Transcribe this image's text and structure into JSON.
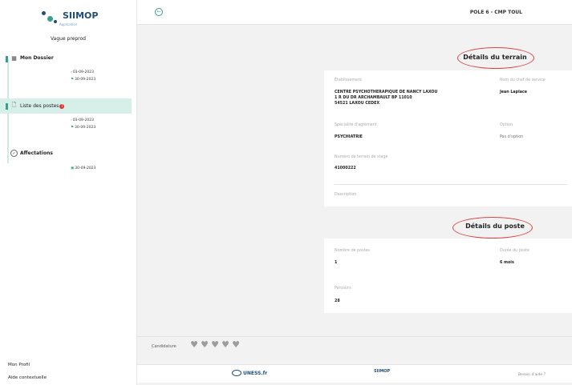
{
  "sidebar": {
    "logo_text": "SIIMOP",
    "logo_sub": "Application",
    "vague": "Vague preprod",
    "steps": [
      {
        "label": "Mon Dossier",
        "dates": [
          "03-09-2023",
          "30-09-2023"
        ]
      },
      {
        "label": "Liste des postes",
        "badge": "1",
        "dates": [
          "03-09-2023",
          "30-09-2023"
        ]
      },
      {
        "label": "Affectations",
        "dates": [
          "30-09-2023"
        ]
      }
    ],
    "links": {
      "profile": "Mon Profil",
      "help": "Aide contextuelle"
    }
  },
  "header": {
    "pole": "POLE 6 - CMP TOUL"
  },
  "terrain": {
    "title": "Détails du terrain",
    "etablissement_label": "Établissement",
    "etablissement_lines": [
      "CENTRE PSYCHOTHERAPIQUE DE NANCY LAXOU",
      "1 R DU DR ARCHAMBAULT BP 11010",
      "54521 LAXOU CEDEX"
    ],
    "chef_label": "Nom du chef de service",
    "chef_value": "Jean Laplace",
    "specialite_label": "Spécialité d'agrément",
    "specialite_value": "PSYCHIATRIE",
    "option_label": "Option",
    "option_value": "Pas d'option",
    "terrain_num_label": "Numéro de terrain de stage",
    "terrain_num_value": "41000222",
    "description_label": "Description"
  },
  "poste": {
    "title": "Détails du poste",
    "nb_label": "Nombre de postes",
    "nb_value": "1",
    "duree_label": "Durée du poste",
    "duree_value": "6 mois",
    "parcours_label": "Parcours",
    "parcours_value": "28"
  },
  "candidature": {
    "label": "Candidature",
    "hearts": 5
  },
  "footer": {
    "uness": "UNESS.fr",
    "siimop": "SIIMOP",
    "help": "Besoin d'aide ?"
  },
  "colors": {
    "accent": "#3a9e8d",
    "circle": "#d64545",
    "brand": "#1f4e79"
  }
}
